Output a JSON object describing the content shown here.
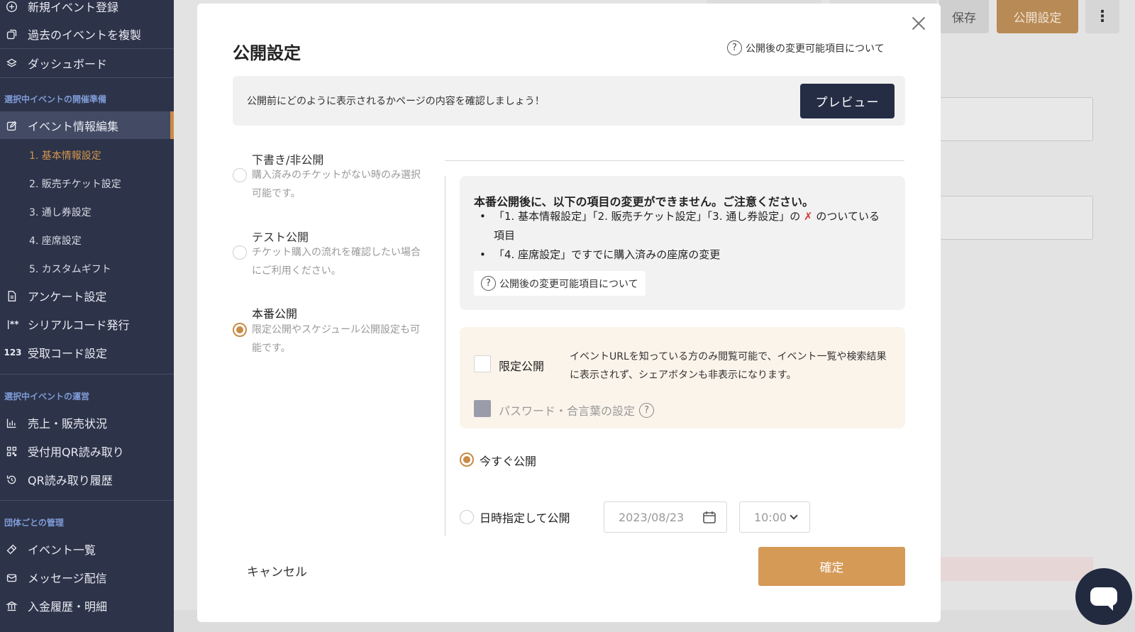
{
  "sidebar": {
    "top_items": [
      {
        "label": "新規イベント登録",
        "icon": "plus-circle-icon"
      },
      {
        "label": "過去のイベントを複製",
        "icon": "copy-icon"
      },
      {
        "label": "ダッシュボード",
        "icon": "layers-icon"
      }
    ],
    "section_prep": "選択中イベントの開催準備",
    "edit_item": {
      "label": "イベント情報編集",
      "icon": "edit-icon"
    },
    "sub_items": [
      "1. 基本情報設定",
      "2. 販売チケット設定",
      "3. 通し券設定",
      "4. 座席設定",
      "5. カスタムギフト"
    ],
    "prep_items": [
      {
        "label": "アンケート設定",
        "icon": "document-icon"
      },
      {
        "label": "シリアルコード発行",
        "icon": "serial-icon",
        "glyph": "|**"
      },
      {
        "label": "受取コード設定",
        "icon": "code-123-icon",
        "glyph": "123"
      }
    ],
    "section_ops": "選択中イベントの運営",
    "ops_items": [
      {
        "label": "売上・販売状況",
        "icon": "bar-chart-icon"
      },
      {
        "label": "受付用QR読み取り",
        "icon": "qr-icon"
      },
      {
        "label": "QR読み取り履歴",
        "icon": "history-icon"
      }
    ],
    "section_org": "団体ごとの管理",
    "org_items": [
      {
        "label": "イベント一覧",
        "icon": "ticket-icon"
      },
      {
        "label": "メッセージ配信",
        "icon": "mail-icon"
      },
      {
        "label": "入金履歴・明細",
        "icon": "bank-icon"
      }
    ]
  },
  "header": {
    "save_label": "保存",
    "publish_label": "公開設定",
    "more_label": "⋮"
  },
  "modal": {
    "title": "公開設定",
    "help_link": "公開後の変更可能項目について",
    "preview_text": "公開前にどのように表示されるかページの内容を確認しましょう！",
    "preview_button": "プレビュー",
    "options": [
      {
        "title": "下書き/非公開",
        "desc": "購入済みのチケットがない時のみ選択可能です。",
        "selected": false
      },
      {
        "title": "テスト公開",
        "desc": "チケット購入の流れを確認したい場合にご利用ください。",
        "selected": false
      },
      {
        "title": "本番公開",
        "desc": "限定公開やスケジュール公開設定も可能です。",
        "selected": true
      }
    ],
    "warning": {
      "title": "本番公開後に、以下の項目の変更ができません。ご注意ください。",
      "item1_text": "「1. 基本情報設定」「2. 販売チケット設定」「3. 通し券設定」の",
      "item1_mark": "✗",
      "item1_tail": "のついている項目",
      "item2": "「4. 座席設定」ですでに購入済みの座席の変更",
      "help_link": "公開後の変更可能項目について"
    },
    "limited": {
      "label": "限定公開",
      "desc": "イベントURLを知っている方のみ閲覧可能で、イベント一覧や検索結果に表示されず、シェアボタンも非表示になります。",
      "password_label": "パスワード・合言葉の設定"
    },
    "publish_now": "今すぐ公開",
    "publish_scheduled": "日時指定して公開",
    "date_placeholder": "2023/08/23",
    "time_value": "10:00",
    "cancel": "キャンセル",
    "confirm": "確定"
  },
  "colors": {
    "sidebar_bg": "#2d3349",
    "accent": "#c98b45",
    "confirm_bg": "#d69a57",
    "preview_btn_bg": "#252d45",
    "warn_red": "#d23a3a"
  }
}
